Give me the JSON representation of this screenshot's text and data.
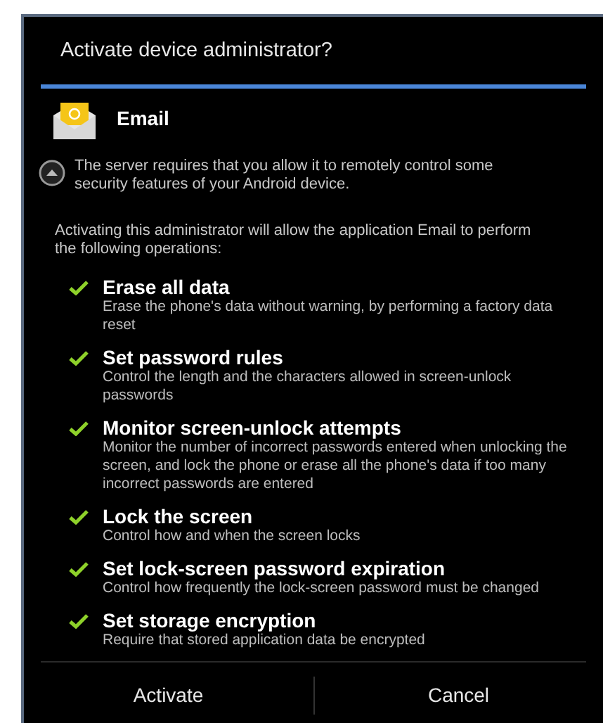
{
  "dialog": {
    "title": "Activate device administrator?"
  },
  "app": {
    "name": "Email"
  },
  "warning": "The server requires that you allow it to remotely control some security features of your Android device.",
  "intro": "Activating this administrator will allow the application Email to perform the following operations:",
  "permissions": [
    {
      "title": "Erase all data",
      "description": "Erase the phone's data without warning, by performing a factory data reset"
    },
    {
      "title": "Set password rules",
      "description": "Control the length and the characters allowed in screen-unlock passwords"
    },
    {
      "title": "Monitor screen-unlock attempts",
      "description": "Monitor the number of incorrect passwords entered when unlocking the screen, and lock the phone or erase all the phone's data if too many incorrect passwords are entered"
    },
    {
      "title": "Lock the screen",
      "description": "Control how and when the screen locks"
    },
    {
      "title": "Set lock-screen password expiration",
      "description": "Control how frequently the lock-screen password must be changed"
    },
    {
      "title": "Set storage encryption",
      "description": "Require that stored application data be encrypted"
    }
  ],
  "buttons": [
    "Activate",
    "Cancel"
  ]
}
